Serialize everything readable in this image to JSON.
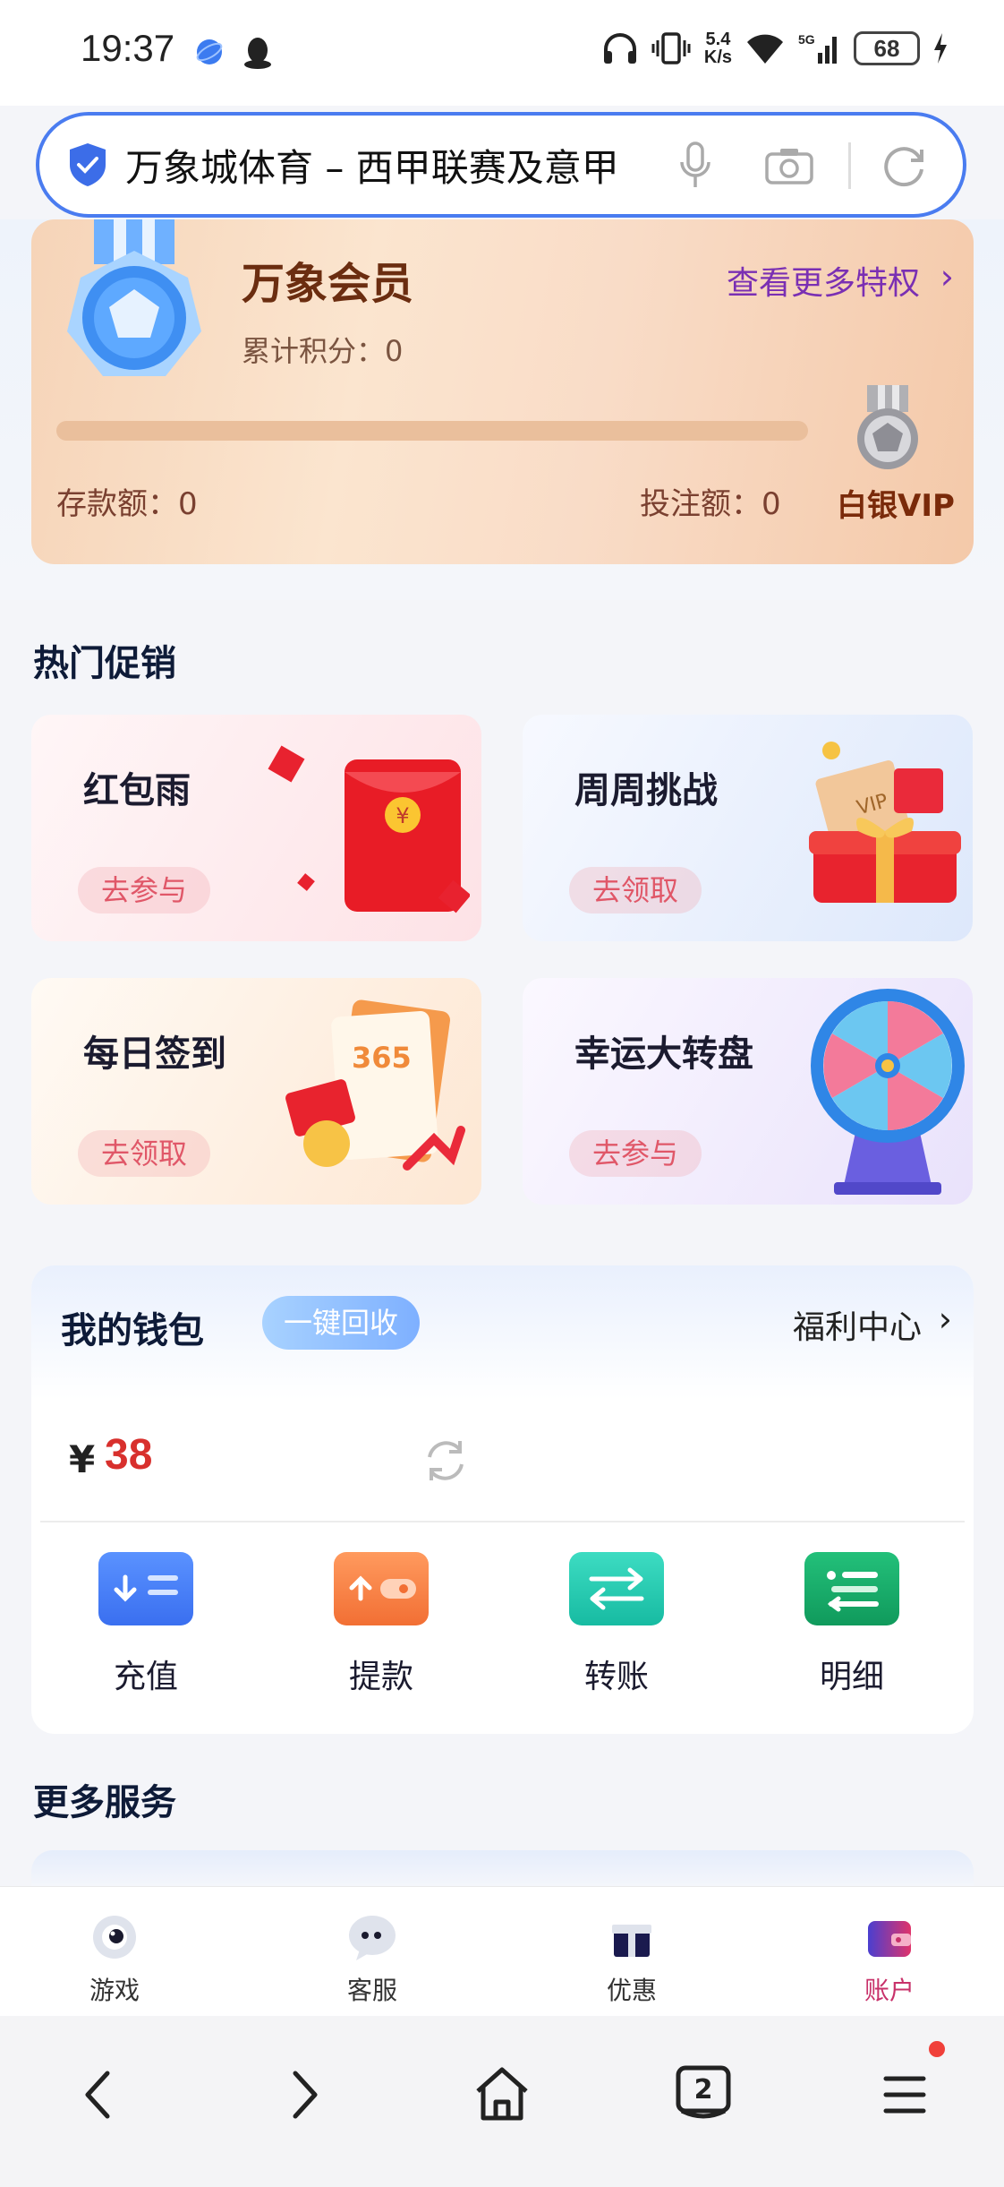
{
  "status_bar": {
    "time": "19:37",
    "speed_top": "5.4",
    "speed_bottom": "K/s",
    "network": "5G",
    "battery": "68"
  },
  "search": {
    "text": "万象城体育 – 西甲联赛及意甲",
    "icons": [
      "shield-icon",
      "mic-icon",
      "camera-icon",
      "refresh-icon"
    ]
  },
  "member": {
    "title": "万象会员",
    "points": "累计积分：0",
    "more_privileges": "查看更多特权",
    "progress": 0,
    "deposit": "存款额：0",
    "bet": "投注额：0",
    "level": "白银VIP"
  },
  "promotions": {
    "title": "热门促销",
    "cards": [
      {
        "title": "红包雨",
        "button": "去参与"
      },
      {
        "title": "周周挑战",
        "button": "去领取"
      },
      {
        "title": "每日签到",
        "button": "去领取"
      },
      {
        "title": "幸运大转盘",
        "button": "去参与"
      }
    ]
  },
  "wallet": {
    "title": "我的钱包",
    "recycle_button": "一键回收",
    "welfare_center": "福利中心",
    "currency": "¥",
    "balance": "38",
    "actions": [
      {
        "label": "充值",
        "color": "#3f7bf2"
      },
      {
        "label": "提款",
        "color": "#f57d44"
      },
      {
        "label": "转账",
        "color": "#1fc7ad"
      },
      {
        "label": "明细",
        "color": "#14a86a"
      }
    ]
  },
  "services": {
    "title": "更多服务"
  },
  "tabbar": {
    "items": [
      {
        "label": "游戏"
      },
      {
        "label": "客服"
      },
      {
        "label": "优惠"
      },
      {
        "label": "账户"
      }
    ],
    "active": "账户"
  },
  "browser_nav": {
    "tab_count": "2"
  },
  "colors": {
    "accent": "#4a7cf0",
    "active_tab": "#c8316a",
    "balance": "#d8302d"
  }
}
